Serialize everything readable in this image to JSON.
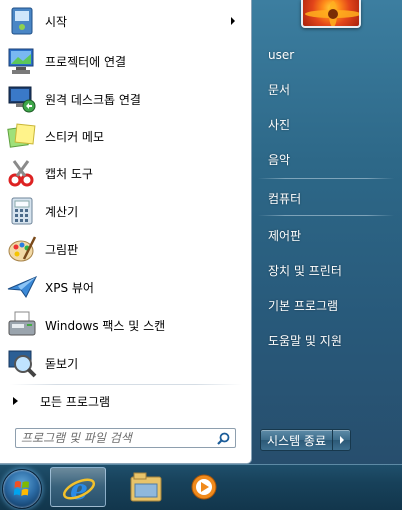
{
  "programs": [
    {
      "label": "시작",
      "icon": "getting-started-icon",
      "submenu": true
    },
    {
      "label": "프로젝터에 연결",
      "icon": "projector-icon"
    },
    {
      "label": "원격 데스크톱 연결",
      "icon": "remote-desktop-icon"
    },
    {
      "label": "스티커 메모",
      "icon": "sticky-notes-icon"
    },
    {
      "label": "캡처 도구",
      "icon": "snipping-tool-icon"
    },
    {
      "label": "계산기",
      "icon": "calculator-icon"
    },
    {
      "label": "그림판",
      "icon": "paint-icon"
    },
    {
      "label": "XPS 뷰어",
      "icon": "xps-viewer-icon"
    },
    {
      "label": "Windows 팩스 및 스캔",
      "icon": "fax-scan-icon"
    },
    {
      "label": "돋보기",
      "icon": "magnifier-icon"
    }
  ],
  "all_programs": "모든 프로그램",
  "search": {
    "placeholder": "프로그램 및 파일 검색"
  },
  "right_items": [
    "user",
    "문서",
    "사진",
    "음악",
    "컴퓨터",
    "제어판",
    "장치 및 프린터",
    "기본 프로그램",
    "도움말 및 지원"
  ],
  "shutdown_label": "시스템 종료",
  "taskbar": {
    "items": [
      "start-orb",
      "internet-explorer-icon",
      "file-explorer-icon",
      "media-player-icon"
    ]
  },
  "colors": {
    "accent": "#2d6888",
    "left_pane": "#ffffff",
    "taskbar": "#17415a"
  }
}
